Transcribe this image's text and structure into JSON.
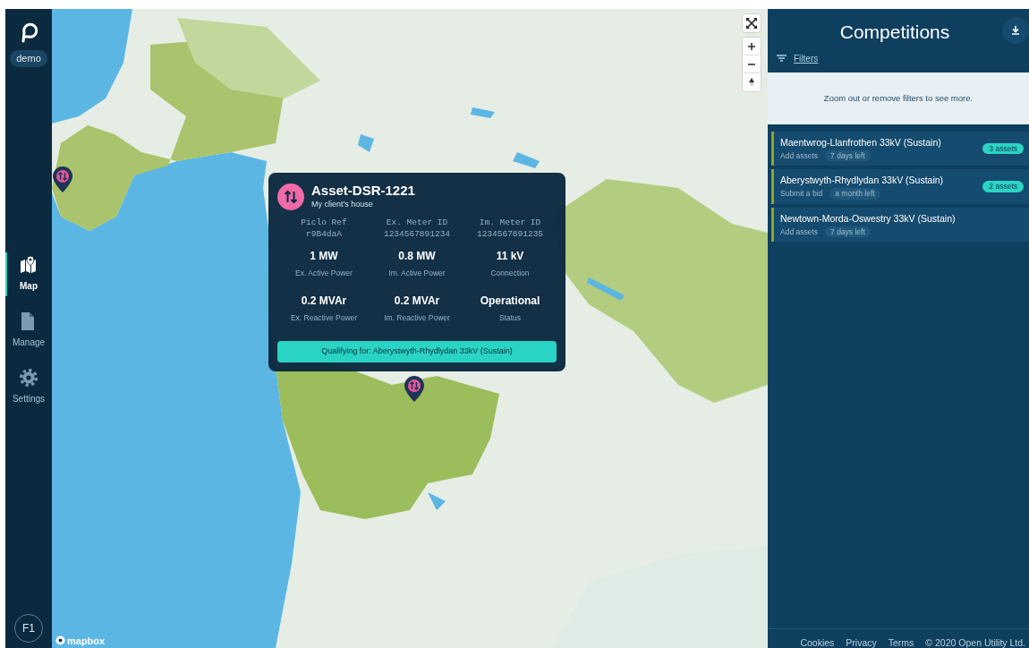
{
  "sidebar": {
    "badge": "demo",
    "nav": [
      {
        "label": "Map",
        "selected": true
      },
      {
        "label": "Manage",
        "selected": false
      },
      {
        "label": "Settings",
        "selected": false
      }
    ],
    "user": "F1"
  },
  "map": {
    "logo": "mapbox"
  },
  "popup": {
    "title": "Asset-DSR-1221",
    "subtitle": "My client's house",
    "ids": [
      {
        "label": "Piclo Ref",
        "value": "r9B4daA"
      },
      {
        "label": "Ex. Meter ID",
        "value": "1234567891234"
      },
      {
        "label": "Im. Meter ID",
        "value": "1234567891235"
      }
    ],
    "stats": [
      {
        "value": "1 MW",
        "label": "Ex. Active Power"
      },
      {
        "value": "0.8 MW",
        "label": "Im. Active Power"
      },
      {
        "value": "11 kV",
        "label": "Connection"
      },
      {
        "value": "0.2 MVAr",
        "label": "Ex. Reactive Power"
      },
      {
        "value": "0.2 MVAr",
        "label": "Im. Reactive Power"
      },
      {
        "value": "Operational",
        "label": "Status"
      }
    ],
    "qualifying": "Qualifying for: Aberystwyth-Rhydlydan 33kV (Sustain)"
  },
  "panel": {
    "title": "Competitions",
    "filters": "Filters",
    "notice": "Zoom out or remove filters to see more.",
    "competitions": [
      {
        "name": "Maentwrog-Llanfrothen 33kV (Sustain)",
        "action": "Add assets",
        "time_left": "7 days left",
        "assets": "3 assets"
      },
      {
        "name": "Aberystwyth-Rhydlydan 33kV (Sustain)",
        "action": "Submit a bid",
        "time_left": "a month left",
        "assets": "2 assets"
      },
      {
        "name": "Newtown-Morda-Oswestry 33kV (Sustain)",
        "action": "Add assets",
        "time_left": "7 days left"
      }
    ]
  },
  "footer": {
    "links": [
      "Cookies",
      "Privacy",
      "Terms"
    ],
    "copyright": "© 2020 Open Utility Ltd."
  }
}
